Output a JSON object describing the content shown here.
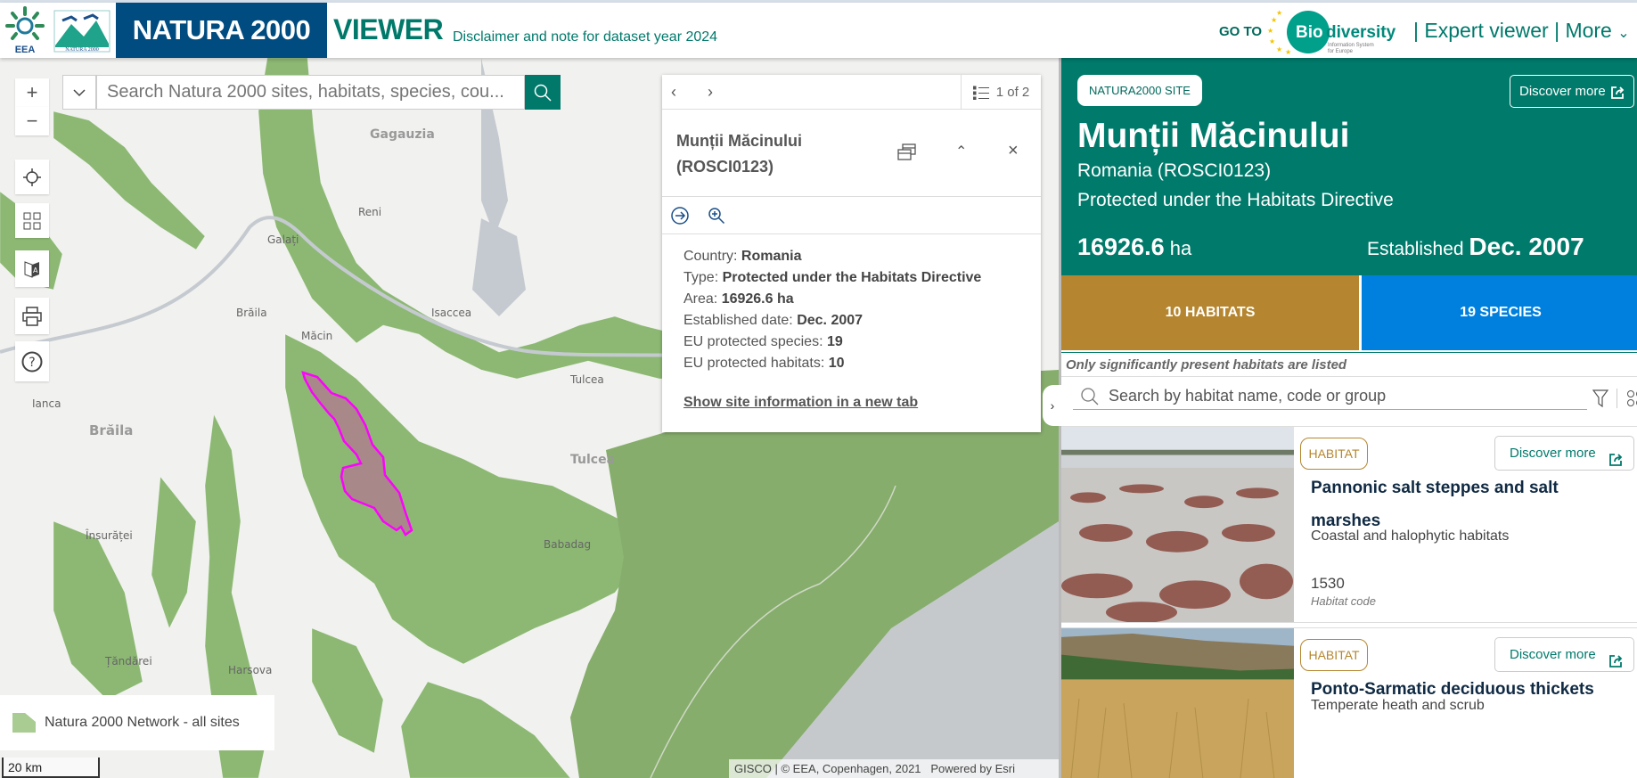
{
  "header": {
    "logo_eea": "EEA",
    "logo_natura": "NATURA 2000",
    "brand": "NATURA 2000",
    "viewer": "VIEWER",
    "disclaimer": "Disclaimer and note for dataset year 2024",
    "goto": "GO TO",
    "bise_logo": "Biodiversity Information System for Europe",
    "links": "| Expert viewer | More",
    "accent": "#00796b",
    "brand_color": "#004b7f"
  },
  "map": {
    "search_placeholder": "Search Natura 2000 sites, habitats, species, cou...",
    "labels": [
      "Gagauzia",
      "Reni",
      "Galați",
      "Brăila",
      "Isaccea",
      "Măcin",
      "Tulcea",
      "Tulcea",
      "Ianca",
      "Brăila",
      "Însurăței",
      "Babadag",
      "Harsova",
      "Țăndărei"
    ],
    "legend": "Natura 2000 Network - all sites",
    "scale": "20 km",
    "attribution": "GISCO | © EEA, Copenhagen, 2021",
    "powered": "Powered by Esri",
    "site_outline_color": "#ff00ff"
  },
  "popup": {
    "page": "1 of 2",
    "title": "Munții Măcinului (ROSCI0123)",
    "fields": [
      {
        "label": "Country: ",
        "value": "Romania"
      },
      {
        "label": "Type: ",
        "value": "Protected under the Habitats Directive"
      },
      {
        "label": "Area: ",
        "value": "16926.6 ha"
      },
      {
        "label": "Established date: ",
        "value": "Dec. 2007"
      },
      {
        "label": "EU protected species: ",
        "value": "19"
      },
      {
        "label": "EU protected habitats: ",
        "value": "10"
      }
    ],
    "link": "Show site information in a new tab"
  },
  "panel": {
    "badge": "NATURA2000 SITE",
    "discover": "Discover more",
    "name": "Munții Măcinului",
    "subtitle": "Romania (ROSCI0123)",
    "type": "Protected under the Habitats Directive",
    "area_value": "16926.6",
    "area_unit": "ha",
    "established_label": "Established",
    "established_value": "Dec. 2007",
    "habitats_tile": "10 HABITATS",
    "species_tile": "19 SPECIES",
    "habitats_color": "#b5862f",
    "species_color": "#0080de",
    "note": "Only significantly present habitats are listed",
    "search_placeholder": "Search by habitat name, code or group",
    "cards": [
      {
        "tag": "HABITAT",
        "discover": "Discover more",
        "name": "Pannonic salt steppes and salt marshes",
        "group": "Coastal and halophytic habitats",
        "code": "1530",
        "code_label": "Habitat code"
      },
      {
        "tag": "HABITAT",
        "discover": "Discover more",
        "name": "Ponto-Sarmatic deciduous thickets",
        "group": "Temperate heath and scrub"
      }
    ]
  }
}
